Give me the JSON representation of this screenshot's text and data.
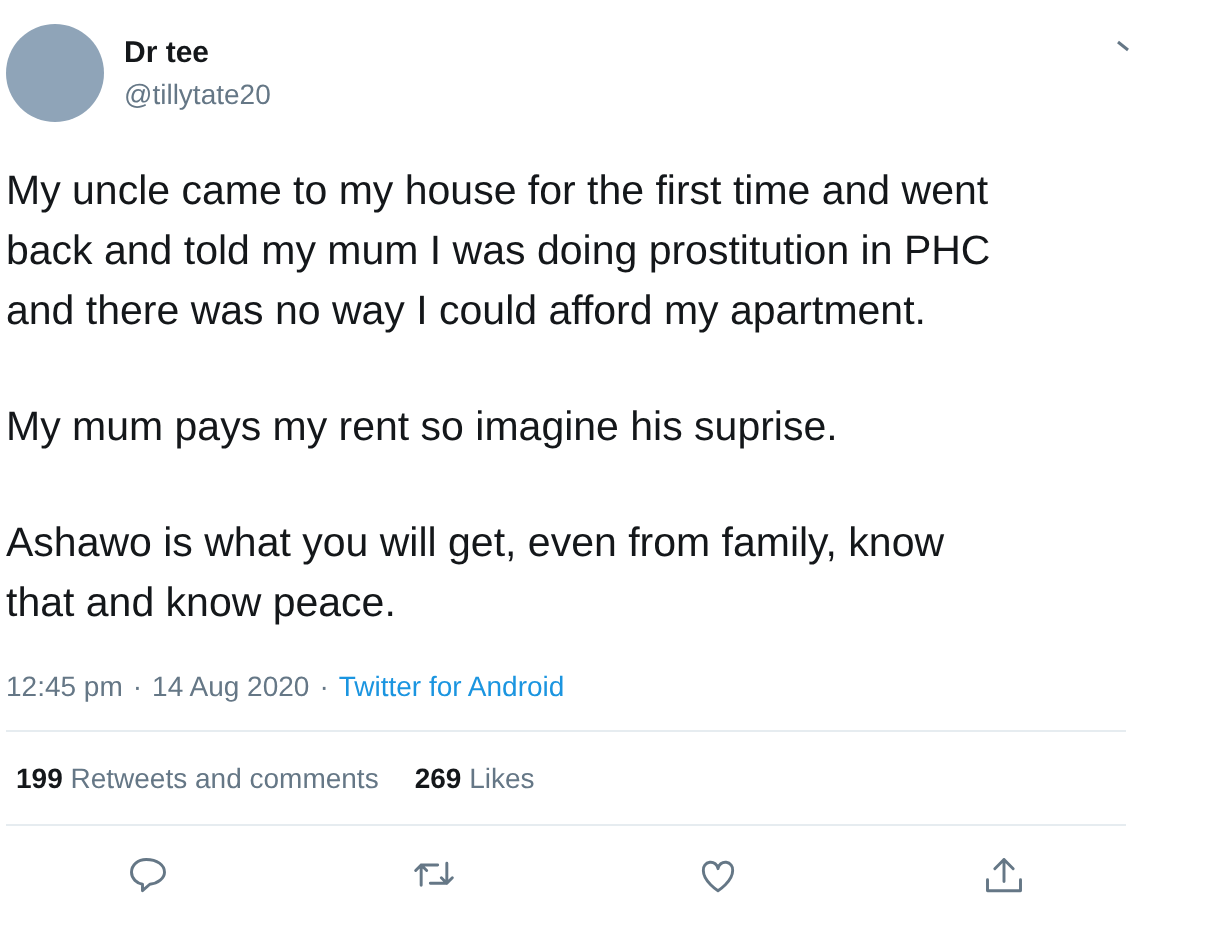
{
  "author": {
    "name": "Dr tee",
    "handle": "@tillytate20"
  },
  "paragraphs": [
    "My uncle came to my house for the first time and went\nback and told my mum I was doing prostitution in PHC\nand there was no way I could afford my apartment.",
    "My mum pays my rent so imagine his suprise.",
    "Ashawo is what you will get, even from family,  know\nthat and know peace."
  ],
  "meta": {
    "time": "12:45 pm",
    "date": "14 Aug 2020",
    "source": "Twitter for Android",
    "separator": "·"
  },
  "stats": [
    {
      "count": "199",
      "label": "Retweets and comments"
    },
    {
      "count": "269",
      "label": "Likes"
    }
  ],
  "actions": [
    {
      "kind": "reply"
    },
    {
      "kind": "retweet"
    },
    {
      "kind": "like"
    },
    {
      "kind": "share"
    }
  ]
}
